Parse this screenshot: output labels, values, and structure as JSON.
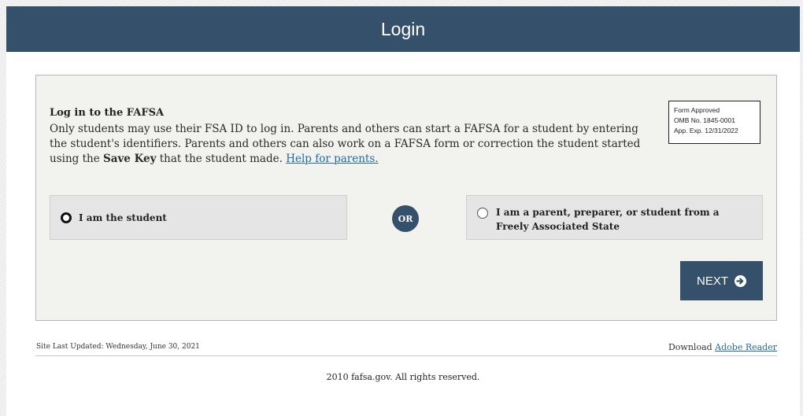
{
  "header": {
    "title": "Login"
  },
  "intro": {
    "title": "Log in to the FAFSA",
    "desc_part1": "Only students may use their FSA ID to log in. Parents and others can start a FAFSA for a student by entering the student's identifiers. Parents and others can also work on a FAFSA form or correction the student started using the ",
    "desc_bold": "Save Key",
    "desc_part2": " that the student made. ",
    "help_link": "Help for parents."
  },
  "omb": {
    "line1": "Form Approved",
    "line2": "OMB No. 1845-0001",
    "line3": "App. Exp. 12/31/2022"
  },
  "options": {
    "student_label": "I am the student",
    "student_selected": true,
    "or_label": "OR",
    "parent_label": "I am a parent, preparer, or student from a Freely Associated State",
    "parent_selected": false
  },
  "next": {
    "label": "NEXT",
    "icon": "arrow-right-circle-icon"
  },
  "footer": {
    "updated": "Site Last Updated: Wednesday, June 30, 2021",
    "download_prefix": "Download ",
    "download_link": "Adobe Reader",
    "copyright": "2010 fafsa.gov. All rights reserved."
  },
  "colors": {
    "brand": "#34506a",
    "link": "#1f6aa5",
    "panel": "#f2f2ee"
  }
}
